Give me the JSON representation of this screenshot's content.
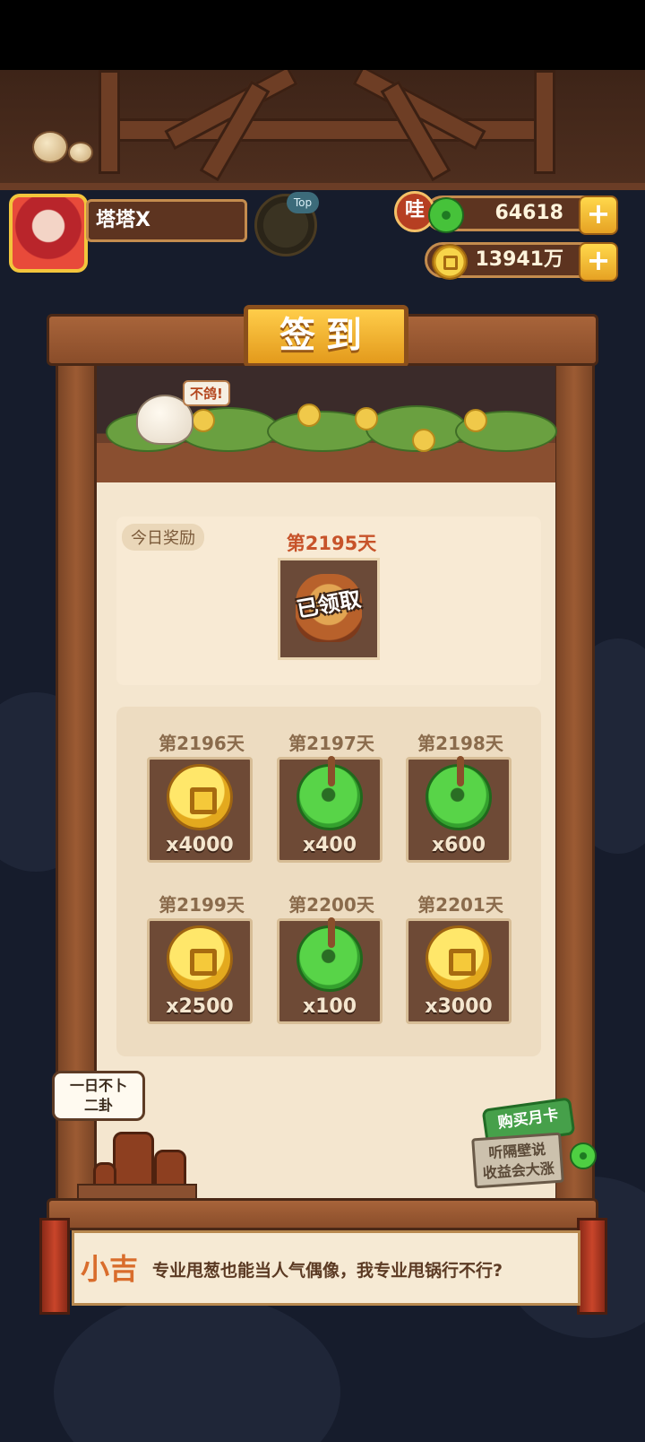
{
  "player": {
    "name": "塔塔X",
    "rank_tag": "Top"
  },
  "currency": {
    "jade_prefix": "哇",
    "jade_amount": "64618",
    "coins_amount": "13941万",
    "plus_label": "+"
  },
  "panel": {
    "title": "签到",
    "chick_speech": "不鸽!"
  },
  "today": {
    "label": "今日奖励",
    "day": "第2195天",
    "status": "已领取"
  },
  "rewards": [
    {
      "day": "第2196天",
      "item": "coin-icon",
      "qty": "x4000"
    },
    {
      "day": "第2197天",
      "item": "jade-icon",
      "qty": "x400"
    },
    {
      "day": "第2198天",
      "item": "jade-icon",
      "qty": "x600"
    },
    {
      "day": "第2199天",
      "item": "coin-icon",
      "qty": "x2500"
    },
    {
      "day": "第2200天",
      "item": "jade-icon",
      "qty": "x100"
    },
    {
      "day": "第2201天",
      "item": "coin-icon",
      "qty": "x3000"
    }
  ],
  "bubble": {
    "line1": "一日不卜",
    "line2": "二卦"
  },
  "month_card": {
    "button": "购买月卡",
    "sign_line1": "听隔壁说",
    "sign_line2": "收益会大涨"
  },
  "dialog": {
    "speaker": "小吉",
    "text": "专业甩葱也能当人气偶像，我专业甩锅行不行?"
  }
}
